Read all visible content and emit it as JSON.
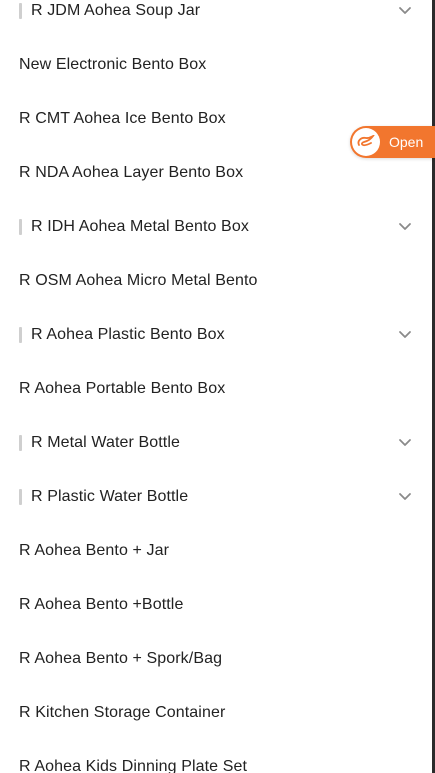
{
  "menu": {
    "items": [
      {
        "label": "R JDM Aohea Soup Jar",
        "expandable": true
      },
      {
        "label": "New Electronic Bento Box",
        "expandable": false
      },
      {
        "label": "R CMT Aohea Ice Bento Box",
        "expandable": false
      },
      {
        "label": "R NDA Aohea Layer Bento Box",
        "expandable": false
      },
      {
        "label": "R IDH Aohea Metal Bento Box",
        "expandable": true
      },
      {
        "label": "R OSM Aohea Micro Metal Bento",
        "expandable": false
      },
      {
        "label": "R Aohea Plastic Bento Box",
        "expandable": true
      },
      {
        "label": "R Aohea Portable Bento Box",
        "expandable": false
      },
      {
        "label": "R Metal Water Bottle",
        "expandable": true
      },
      {
        "label": "R Plastic Water Bottle",
        "expandable": true
      },
      {
        "label": "R Aohea Bento + Jar",
        "expandable": false
      },
      {
        "label": "R Aohea Bento +Bottle",
        "expandable": false
      },
      {
        "label": "R Aohea Bento + Spork/Bag",
        "expandable": false
      },
      {
        "label": "R Kitchen Storage Container",
        "expandable": false
      },
      {
        "label": "R Aohea Kids Dinning Plate Set",
        "expandable": false
      }
    ]
  },
  "open_button": {
    "label": "Open",
    "icon": "alibaba-logo-icon",
    "color": "#f2762e"
  },
  "colors": {
    "text": "#222222",
    "group_bar": "#cfcfcf",
    "chevron": "#8a8a8a"
  }
}
